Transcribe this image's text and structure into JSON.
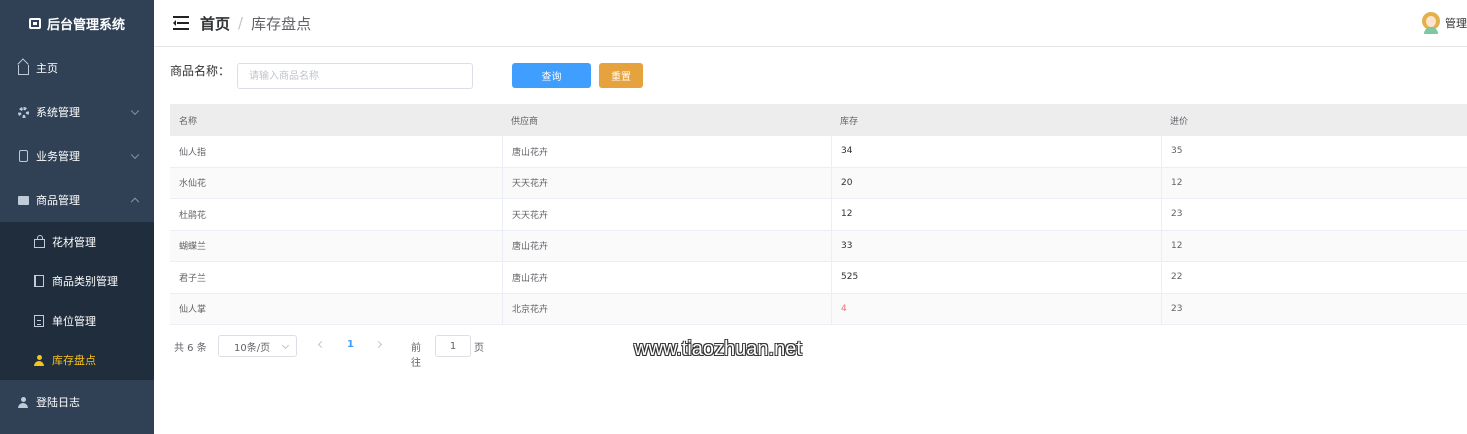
{
  "sidebar": {
    "brand": "后台管理系统",
    "items": [
      {
        "label": "主页",
        "icon": "home-icon"
      },
      {
        "label": "系统管理",
        "icon": "gear-icon",
        "expandable": true
      },
      {
        "label": "业务管理",
        "icon": "phone-icon",
        "expandable": true
      },
      {
        "label": "商品管理",
        "icon": "goods-icon",
        "expandable": true,
        "expanded": true,
        "children": [
          {
            "label": "花材管理",
            "icon": "bag-icon"
          },
          {
            "label": "商品类别管理",
            "icon": "book-icon"
          },
          {
            "label": "单位管理",
            "icon": "document-icon"
          },
          {
            "label": "库存盘点",
            "icon": "user-icon",
            "active": true
          }
        ]
      },
      {
        "label": "登陆日志",
        "icon": "user-icon"
      }
    ],
    "active_color": "#f7c21a",
    "bg_color": "#304156"
  },
  "header": {
    "breadcrumb_home": "首页",
    "breadcrumb_sep": "/",
    "breadcrumb_current": "库存盘点",
    "user_name": "管理"
  },
  "search": {
    "label": "商品名称：",
    "placeholder": "请输入商品名称",
    "query_label": "查询",
    "reset_label": "重置"
  },
  "table": {
    "columns": [
      "名称",
      "供应商",
      "库存",
      "进价"
    ],
    "rows": [
      {
        "name": "仙人指",
        "supplier": "唐山花卉",
        "stock": "34",
        "price": "35"
      },
      {
        "name": "水仙花",
        "supplier": "天天花卉",
        "stock": "20",
        "price": "12"
      },
      {
        "name": "杜鹃花",
        "supplier": "天天花卉",
        "stock": "12",
        "price": "23"
      },
      {
        "name": "蝴蝶兰",
        "supplier": "唐山花卉",
        "stock": "33",
        "price": "12"
      },
      {
        "name": "君子兰",
        "supplier": "唐山花卉",
        "stock": "525",
        "price": "22"
      },
      {
        "name": "仙人掌",
        "supplier": "北京花卉",
        "stock": "4",
        "price": "23",
        "low_stock": true
      }
    ],
    "low_stock_color": "#f56c6c"
  },
  "pagination": {
    "total": "共 6 条",
    "page_size": "10条/页",
    "current_page": "1",
    "goto_label": "前往",
    "goto_value": "1",
    "goto_suffix": "页"
  },
  "watermark": "www.tiaozhuan.net",
  "colors": {
    "primary": "#409eff",
    "warning": "#e6a23c"
  }
}
